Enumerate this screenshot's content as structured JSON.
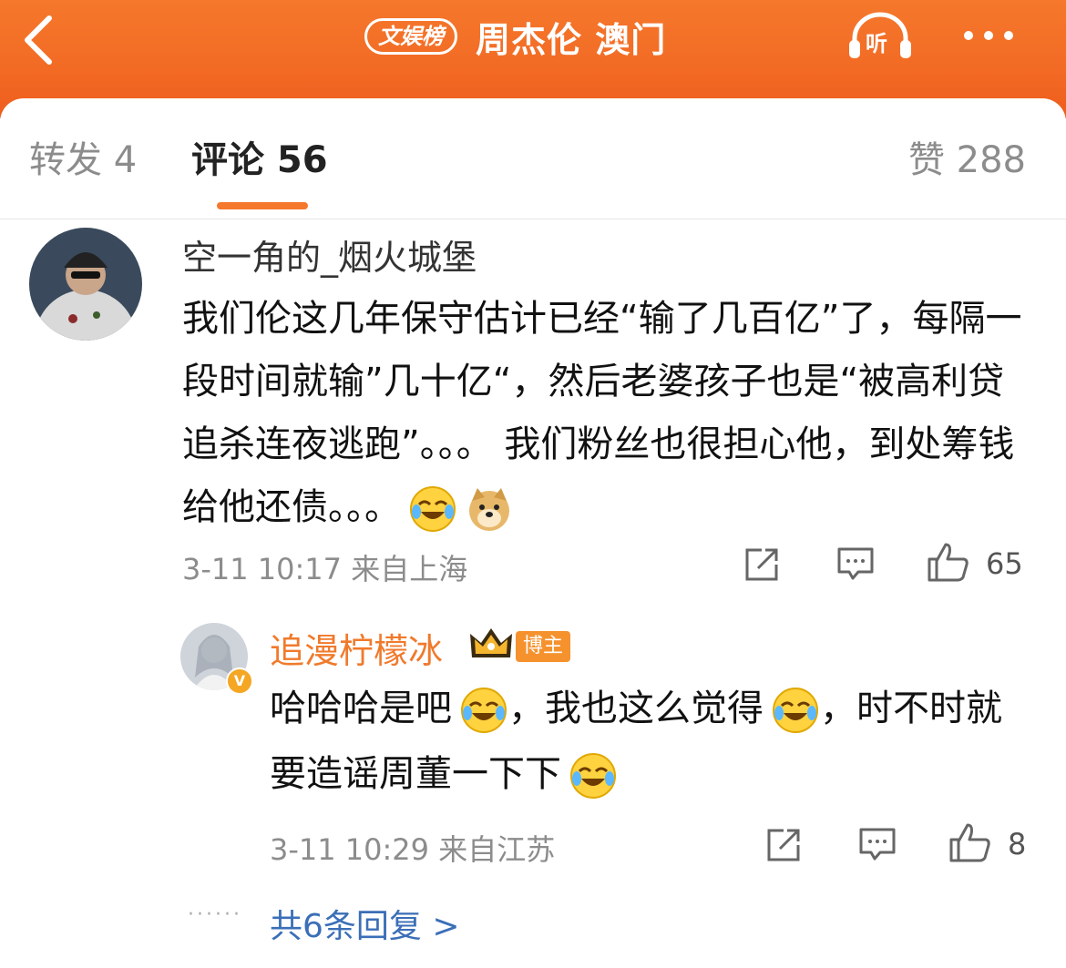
{
  "header": {
    "chip_label": "文娱榜",
    "title": "周杰伦 澳门",
    "listen_label": "听"
  },
  "tabs": {
    "repost": "转发 4",
    "comment": "评论 56",
    "like": "赞 288"
  },
  "comment": {
    "username": "空一角的_烟火城堡",
    "text": "我们伦这几年保守估计已经“输了几百亿”了，每隔一段时间就输”几十亿“，然后老婆孩子也是“被高利贷追杀连夜逃跑”。。。 我们粉丝也很担心他，到处筹钱给他还债。。。",
    "meta": "3-11 10:17  来自上海",
    "like_count": "65"
  },
  "reply": {
    "username": "追漫柠檬冰",
    "badge": "博主",
    "verified_mark": "V",
    "text_parts": [
      "哈哈哈是吧",
      "，我也这么觉得",
      "，时不时就要造谣周董一下下"
    ],
    "meta": "3-11 10:29  来自江苏",
    "like_count": "8"
  },
  "more_replies": "共6条回复 >",
  "colors": {
    "brand_orange": "#f26a24",
    "link_blue": "#3b6fb7",
    "username_orange": "#f07a2c"
  }
}
